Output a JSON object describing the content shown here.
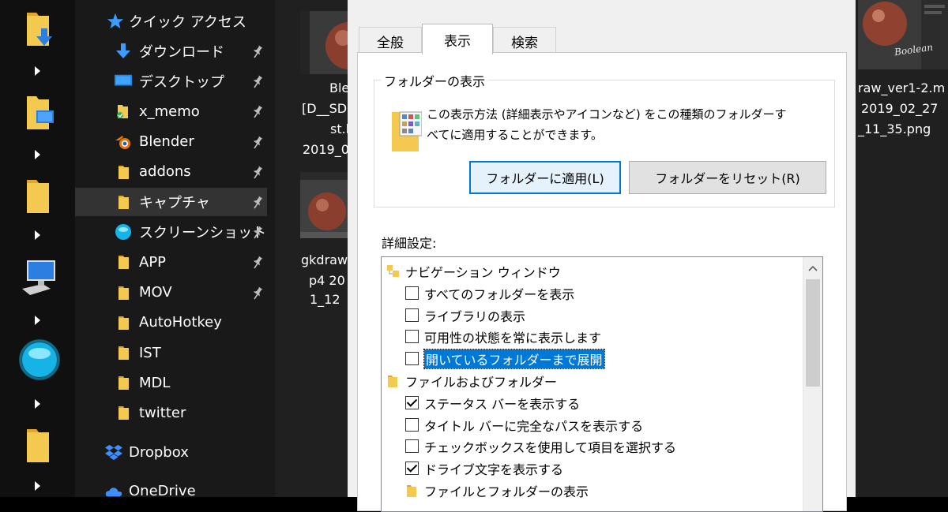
{
  "quick_access": {
    "label": "クイック アクセス",
    "items": [
      {
        "label": "ダウンロード",
        "icon": "download-icon",
        "pinned": true
      },
      {
        "label": "デスクトップ",
        "icon": "desktop-icon",
        "pinned": true
      },
      {
        "label": "x_memo",
        "icon": "folder-synced-icon",
        "pinned": true
      },
      {
        "label": "Blender",
        "icon": "blender-icon",
        "pinned": true
      },
      {
        "label": "addons",
        "icon": "folder-icon",
        "pinned": true
      },
      {
        "label": "キャプチャ",
        "icon": "folder-icon",
        "pinned": true,
        "selected": true
      },
      {
        "label": "スクリーンショット",
        "icon": "screenshot-orb-icon",
        "pinned": true
      },
      {
        "label": "APP",
        "icon": "folder-icon",
        "pinned": true
      },
      {
        "label": "MOV",
        "icon": "folder-icon",
        "pinned": true
      },
      {
        "label": "AutoHotkey",
        "icon": "folder-icon",
        "pinned": false
      },
      {
        "label": "IST",
        "icon": "folder-icon",
        "pinned": false
      },
      {
        "label": "MDL",
        "icon": "folder-icon",
        "pinned": false
      },
      {
        "label": "twitter",
        "icon": "folder-icon",
        "pinned": false
      }
    ]
  },
  "dropbox": {
    "label": "Dropbox",
    "icon": "dropbox-icon"
  },
  "onedrive": {
    "label": "OneDrive",
    "icon": "onedrive-icon"
  },
  "files": {
    "file1_lines": [
      "Ble",
      "[D__SD",
      "st.b",
      "2019_0"
    ],
    "file2_lines": [
      "gkdraw",
      "p4 20",
      "1_12"
    ],
    "file3_lines": [
      "raw_ver1-2.m",
      "2019_02_27",
      "_11_35.png"
    ],
    "thumb_text": "Boolean"
  },
  "dialog": {
    "tabs": [
      "全般",
      "表示",
      "検索"
    ],
    "active_tab": 1,
    "folder_views": {
      "legend": "フォルダーの表示",
      "desc_line1": "この表示方法 (詳細表示やアイコンなど) をこの種類のフォルダーす",
      "desc_line2": "べてに適用することができます。",
      "apply_button": "フォルダーに適用(L)",
      "reset_button": "フォルダーをリセット(R)"
    },
    "advanced_label": "詳細設定:",
    "tree": [
      {
        "type": "group",
        "label": "ナビゲーション ウィンドウ",
        "icon": "navigation-pane-icon"
      },
      {
        "type": "checkbox",
        "label": "すべてのフォルダーを表示",
        "checked": false
      },
      {
        "type": "checkbox",
        "label": "ライブラリの表示",
        "checked": false
      },
      {
        "type": "checkbox",
        "label": "可用性の状態を常に表示します",
        "checked": false
      },
      {
        "type": "checkbox",
        "label": "開いているフォルダーまで展開",
        "checked": false,
        "highlighted": true
      },
      {
        "type": "group",
        "label": "ファイルおよびフォルダー",
        "icon": "folder-icon"
      },
      {
        "type": "checkbox",
        "label": "ステータス バーを表示する",
        "checked": true
      },
      {
        "type": "checkbox",
        "label": "タイトル バーに完全なパスを表示する",
        "checked": false
      },
      {
        "type": "checkbox",
        "label": "チェックボックスを使用して項目を選択する",
        "checked": false
      },
      {
        "type": "checkbox",
        "label": "ドライブ文字を表示する",
        "checked": true
      },
      {
        "type": "subgroup",
        "label": "ファイルとフォルダーの表示",
        "icon": "folder-icon"
      }
    ]
  },
  "colors": {
    "folder": "#f3c94f",
    "accent": "#0078d7",
    "nav_bg": "#191919",
    "files_bg": "#202020",
    "dialog_bg": "#f0f0f0"
  }
}
